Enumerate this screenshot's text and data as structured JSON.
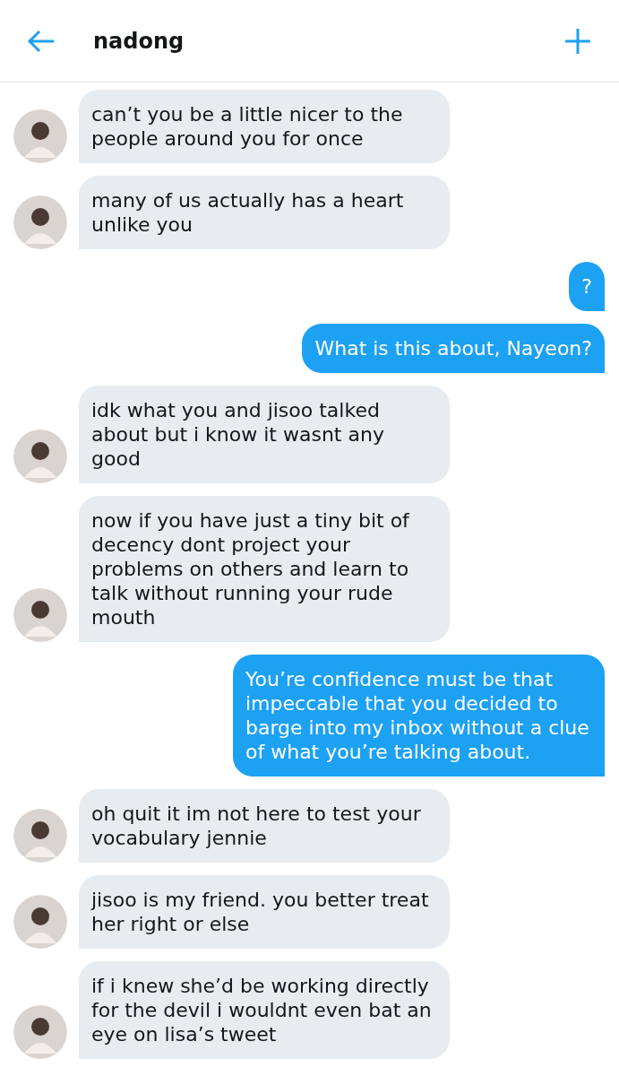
{
  "header": {
    "title": "nadong"
  },
  "messages": [
    {
      "kind": "received",
      "text": "can’t you be a little nicer to the people around you for once"
    },
    {
      "kind": "received",
      "text": "many of us actually has a heart unlike you"
    },
    {
      "kind": "sent",
      "text": "?"
    },
    {
      "kind": "sent",
      "text": "What is this about, Nayeon?"
    },
    {
      "kind": "received",
      "text": "idk what you and jisoo talked about but i know it wasnt any good"
    },
    {
      "kind": "received",
      "text": "now if you have just a tiny bit of decency dont project your problems on others and learn to talk without running your rude mouth"
    },
    {
      "kind": "sent",
      "text": "You’re confidence must be that impeccable that you decided to barge into my inbox without a clue of what you’re talking about."
    },
    {
      "kind": "received",
      "text": "oh quit it im not here to test your vocabulary jennie"
    },
    {
      "kind": "received",
      "text": "jisoo is my friend. you better treat her right or else"
    },
    {
      "kind": "received",
      "text": "if i knew she’d be working directly for the devil i wouldnt even bat an eye on lisa’s tweet"
    }
  ]
}
